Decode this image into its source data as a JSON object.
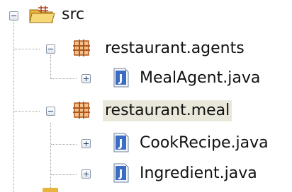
{
  "tree": {
    "root": {
      "label": "src",
      "expanded": true,
      "icon": "source-folder-icon"
    },
    "items": [
      {
        "label": "restaurant.agents",
        "type": "package",
        "expanded": true,
        "icon": "package-icon"
      },
      {
        "label": "MealAgent.java",
        "type": "java-file",
        "expanded": false,
        "icon": "java-file-icon"
      },
      {
        "label": "restaurant.meal",
        "type": "package",
        "expanded": true,
        "selected": true,
        "icon": "package-icon"
      },
      {
        "label": "CookRecipe.java",
        "type": "java-file",
        "expanded": false,
        "icon": "java-file-icon"
      },
      {
        "label": "Ingredient.java",
        "type": "java-file",
        "expanded": false,
        "icon": "java-file-icon"
      }
    ]
  },
  "colors": {
    "package_icon": "#d9822b",
    "java_icon": "#3b6cc5",
    "folder_icon": "#e7b43c",
    "selection": "#eae8da"
  }
}
